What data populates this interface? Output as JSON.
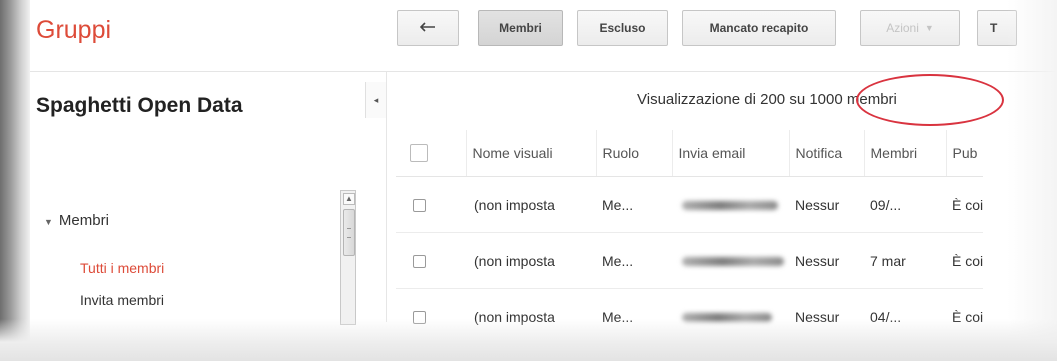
{
  "app": {
    "title": "Gruppi"
  },
  "toolbar": {
    "back_icon": "back-arrow-icon",
    "members_label": "Membri",
    "excluded_label": "Escluso",
    "undelivered_label": "Mancato recapito",
    "actions_label": "Azioni",
    "more_label": "T"
  },
  "sidebar": {
    "group_name": "Spaghetti Open Data",
    "collapse_icon": "collapse-left-icon",
    "section_label": "Membri",
    "items": [
      {
        "label": "Tutti i membri",
        "active": true
      },
      {
        "label": "Invita membri",
        "active": false
      }
    ]
  },
  "main": {
    "summary_prefix": "Visualizzazione di 200 su",
    "summary_count": "1000 membri",
    "columns": [
      "Nome visuali",
      "Ruolo",
      "Invia email",
      "Notifica",
      "Membri",
      "Pub"
    ],
    "rows": [
      {
        "name": "(non imposta",
        "role": "Me...",
        "email_blur_width": 0.85,
        "notification": "Nessur",
        "member_since": "09/...",
        "public": "È coi"
      },
      {
        "name": "(non imposta",
        "role": "Me...",
        "email_blur_width": 0.9,
        "notification": "Nessur",
        "member_since": "7 mar",
        "public": "È coi"
      },
      {
        "name": "(non imposta",
        "role": "Me...",
        "email_blur_width": 0.8,
        "notification": "Nessur",
        "member_since": "04/...",
        "public": "È coi"
      }
    ]
  },
  "colors": {
    "accent": "#dd4b39",
    "highlight_ring": "#d9333f"
  }
}
